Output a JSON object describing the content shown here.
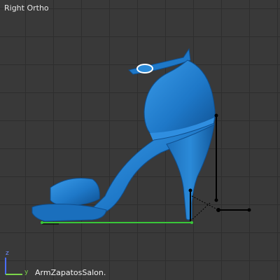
{
  "viewport": {
    "view_name": "Right Ortho",
    "active_object": "ArmZapatosSalon."
  },
  "axis_gizmo": {
    "vertical_axis": "z",
    "horizontal_axis": "y",
    "vertical_color": "#4a6dff",
    "horizontal_color": "#7cd64a"
  },
  "colors": {
    "background": "#393939",
    "grid_line": "#2e2e2e",
    "shoe_body": "#1e78c8",
    "shoe_highlight": "#3a9be8",
    "shoe_shadow": "#0f4f8f",
    "armature_bone": "#000000",
    "selected_bone": "#39c739",
    "buckle_outline": "#ffffff"
  },
  "icons": {
    "shoe": "high-heel-sandal",
    "armature": "armature-bones",
    "gizmo": "axis-gizmo"
  }
}
